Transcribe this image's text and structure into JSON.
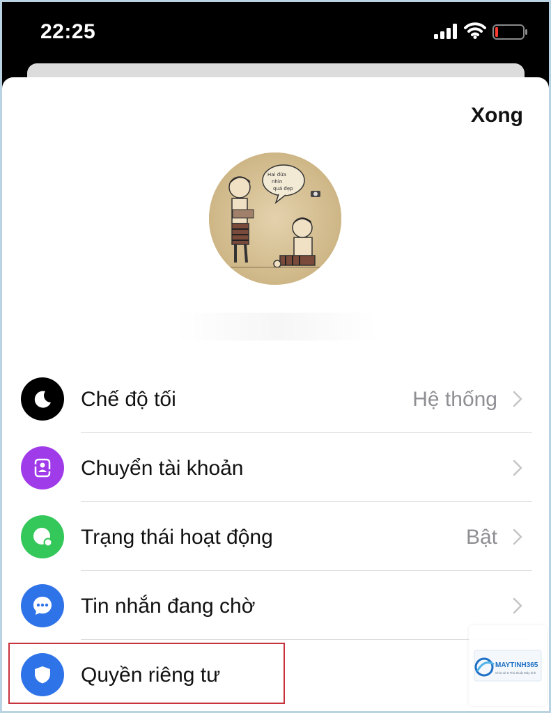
{
  "status_bar": {
    "time": "22:25",
    "icons": [
      "cellular-signal-icon",
      "wifi-icon",
      "battery-low-icon"
    ]
  },
  "header": {
    "done_label": "Xong"
  },
  "profile": {
    "avatar": "profile-avatar-illustration",
    "avatar_text": "Hai đứa nhìn quá đẹp"
  },
  "menu": {
    "items": [
      {
        "label": "Chế độ tối",
        "value": "Hệ thống",
        "icon": "moon-icon",
        "color": "#000000"
      },
      {
        "label": "Chuyển tài khoản",
        "value": "",
        "icon": "switch-account-icon",
        "color": "#a03bea"
      },
      {
        "label": "Trạng thái hoạt động",
        "value": "Bật",
        "icon": "active-status-icon",
        "color": "#34c759"
      },
      {
        "label": "Tin nhắn đang chờ",
        "value": "",
        "icon": "pending-messages-icon",
        "color": "#2f73e8"
      },
      {
        "label": "Quyền riêng tư",
        "value": "",
        "icon": "privacy-shield-icon",
        "color": "#2f73e8"
      }
    ]
  },
  "watermark": {
    "brand": "MAYTINH365",
    "tagline": "Chia sẻ & Thủ thuật Máy tính"
  },
  "colors": {
    "highlight_border": "#c8323c",
    "secondary_text": "#8e8e93"
  }
}
